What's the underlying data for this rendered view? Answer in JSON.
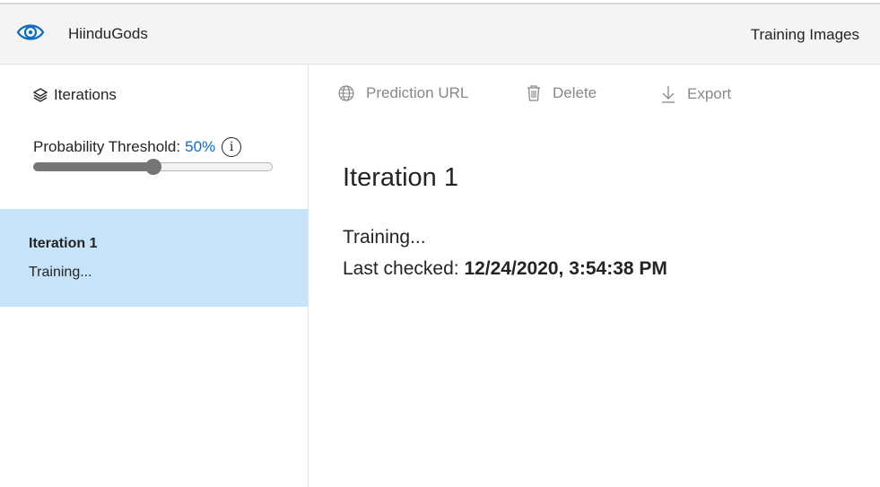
{
  "header": {
    "project_name": "HiinduGods",
    "training_images_tab": "Training Images"
  },
  "sidebar": {
    "iterations_label": "Iterations",
    "threshold_label": "Probability Threshold:",
    "threshold_value": "50%",
    "threshold_fraction": 0.5,
    "info_glyph": "i",
    "iteration_items": [
      {
        "name": "Iteration 1",
        "status": "Training..."
      }
    ]
  },
  "toolbar": {
    "prediction_url": "Prediction URL",
    "delete": "Delete",
    "export": "Export"
  },
  "main": {
    "title": "Iteration 1",
    "status": "Training...",
    "last_checked_label": "Last checked:",
    "last_checked_value": "12/24/2020, 3:54:38 PM"
  },
  "colors": {
    "accent": "#0f6cbd",
    "selected_item_bg": "#c7e3fa",
    "header_bg": "#f4f4f4",
    "disabled_text": "#8a8886"
  },
  "icons": [
    "eye-logo-icon",
    "layers-icon",
    "info-icon",
    "globe-icon",
    "trash-icon",
    "download-icon"
  ]
}
